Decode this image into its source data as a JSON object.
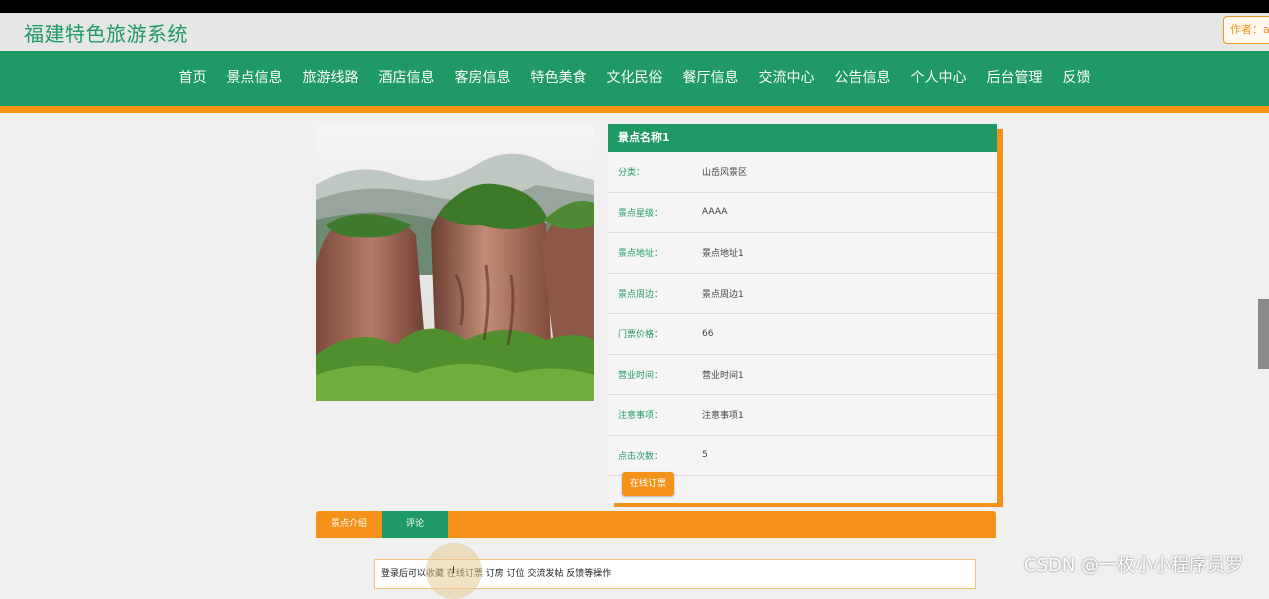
{
  "site": {
    "title": "福建特色旅游系统",
    "author_label": "作者：a"
  },
  "nav": {
    "items": [
      "首页",
      "景点信息",
      "旅游线路",
      "酒店信息",
      "客房信息",
      "特色美食",
      "文化民俗",
      "餐厅信息",
      "交流中心",
      "公告信息",
      "个人中心",
      "后台管理",
      "反馈"
    ]
  },
  "detail": {
    "name": "景点名称1",
    "rows": [
      {
        "label": "分类：",
        "value": "山岳风景区"
      },
      {
        "label": "景点星级：",
        "value": "AAAA"
      },
      {
        "label": "景点地址：",
        "value": "景点地址1"
      },
      {
        "label": "景点周边：",
        "value": "景点周边1"
      },
      {
        "label": "门票价格：",
        "value": "66"
      },
      {
        "label": "营业时间：",
        "value": "营业时间1"
      },
      {
        "label": "注意事项：",
        "value": "注意事项1"
      },
      {
        "label": "点击次数：",
        "value": "5"
      }
    ],
    "book_button": "在线订票"
  },
  "tabs": [
    "景点介绍",
    "评论"
  ],
  "notice": "登录后可以收藏 在线订票 订房 订位 交流发帖 反馈等操作",
  "watermark": "CSDN @一枚小小程序员罗",
  "colors": {
    "primary": "#1f9a64",
    "accent": "#f39118"
  }
}
